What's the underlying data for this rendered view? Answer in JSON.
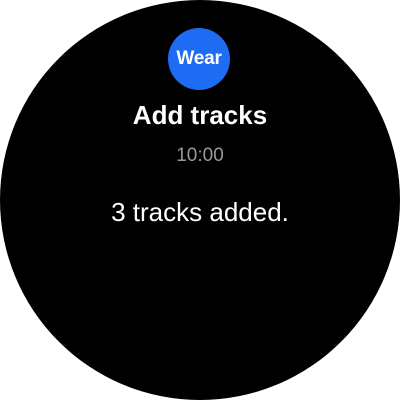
{
  "app": {
    "icon_label": "Wear",
    "icon_color": "#1f6cf4"
  },
  "notification": {
    "title": "Add tracks",
    "time": "10:00",
    "message": "3 tracks added."
  }
}
